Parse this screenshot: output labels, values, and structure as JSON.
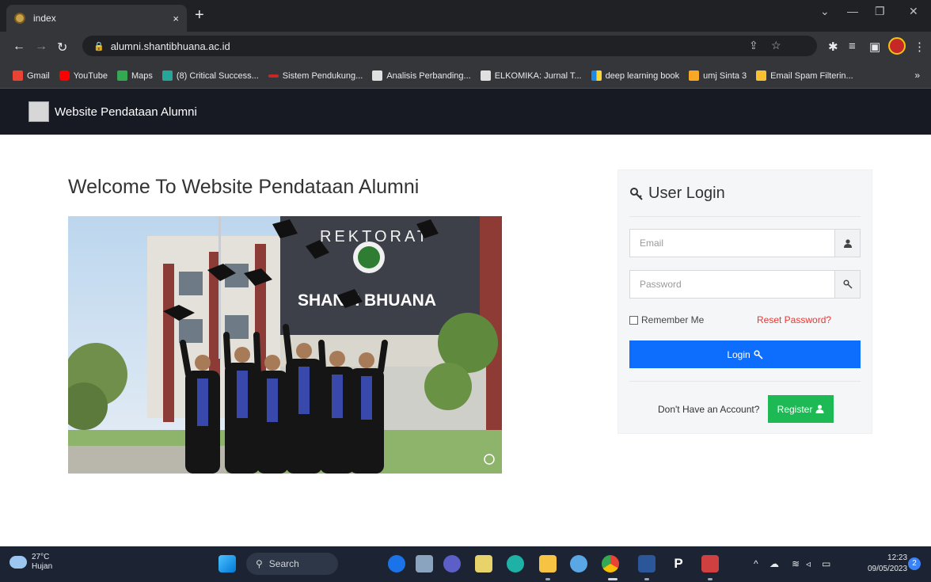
{
  "browser": {
    "tab_title": "index",
    "tab_close": "×",
    "new_tab": "+",
    "url": "alumni.shantibhuana.ac.id",
    "bookmarks": [
      {
        "label": "Gmail",
        "color": "#ea4335"
      },
      {
        "label": "YouTube",
        "color": "#ff0000"
      },
      {
        "label": "Maps",
        "color": "#34a853"
      },
      {
        "label": "(8) Critical Success...",
        "color": "#26a69a"
      },
      {
        "label": "Sistem Pendukung...",
        "color": "#c62828"
      },
      {
        "label": "Analisis Perbanding...",
        "color": "#e0e0e0"
      },
      {
        "label": "ELKOMIKA: Jurnal T...",
        "color": "#e0e0e0"
      },
      {
        "label": "deep learning book",
        "color": "#1e88e5"
      },
      {
        "label": "umj Sinta 3",
        "color": "#f9a825"
      },
      {
        "label": "Email Spam Filterin...",
        "color": "#fbc02d"
      }
    ],
    "bookmarks_more": "»"
  },
  "site": {
    "brand": "Website Pendataan Alumni",
    "welcome": "Welcome To Website Pendataan Alumni",
    "photo_sign_top": "REKTORAT",
    "photo_sign_main": "SHANTI BHUANA"
  },
  "login": {
    "title": "User Login",
    "email_placeholder": "Email",
    "password_placeholder": "Password",
    "remember": "Remember Me",
    "reset": "Reset Password?",
    "login_button": "Login",
    "no_account": "Don't Have an Account?",
    "register_button": "Register"
  },
  "taskbar": {
    "temperature": "27°C",
    "weather": "Hujan",
    "search": "Search",
    "time": "12:23",
    "date": "09/05/2023",
    "notifications": "2"
  },
  "colors": {
    "navbar": "#171923",
    "login_button": "#0d6efd",
    "register_button": "#1db954",
    "reset_link": "#e53935"
  }
}
